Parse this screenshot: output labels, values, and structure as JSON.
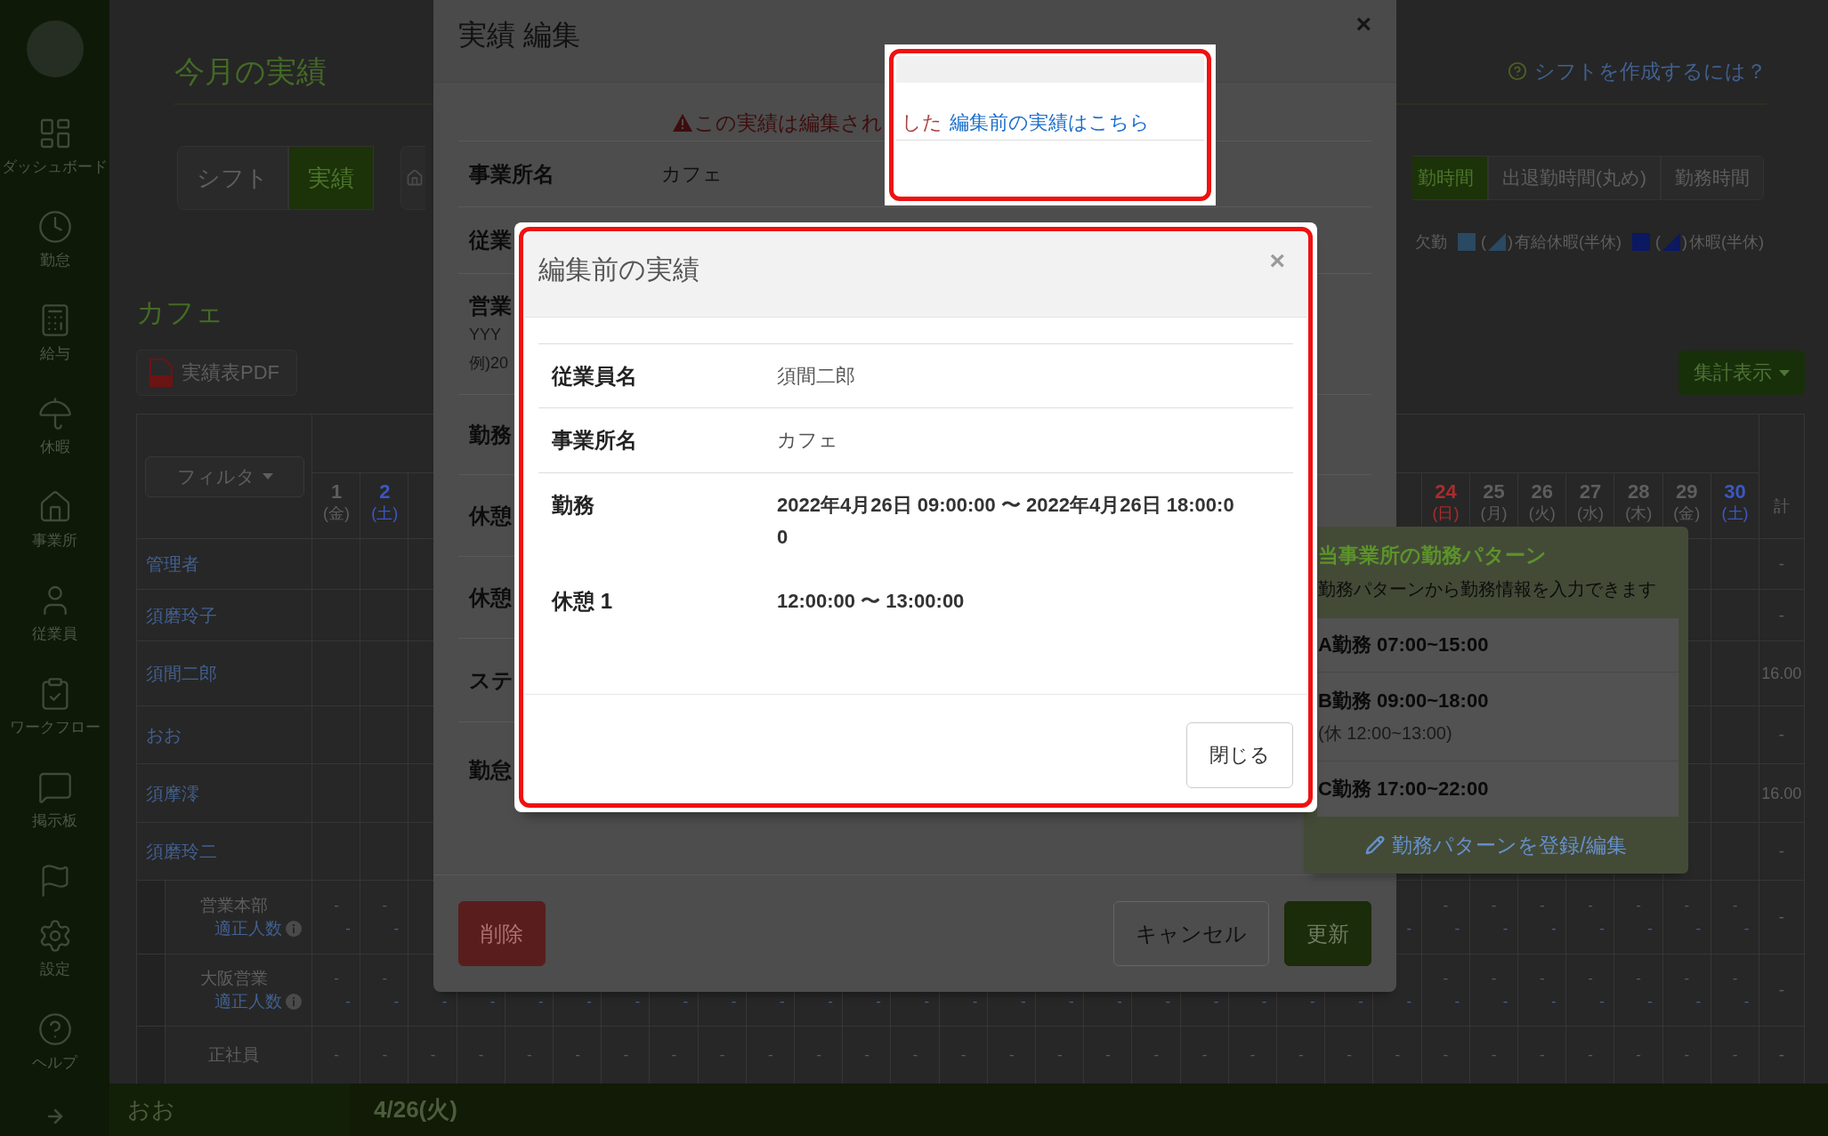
{
  "sidebar": {
    "items": [
      {
        "kind": "labeled",
        "label": "ダッシュボード"
      },
      {
        "kind": "labeled",
        "label": "勤怠"
      },
      {
        "kind": "labeled",
        "label": "給与"
      },
      {
        "kind": "labeled",
        "label": "休暇"
      },
      {
        "kind": "labeled",
        "label": "事業所"
      },
      {
        "kind": "labeled",
        "label": "従業員"
      },
      {
        "kind": "labeled",
        "label": "ワークフロー"
      },
      {
        "kind": "labeled",
        "label": "掲示板"
      },
      {
        "kind": "icon_only"
      },
      {
        "kind": "labeled",
        "label": "設定"
      },
      {
        "kind": "labeled",
        "label": "ヘルプ"
      }
    ]
  },
  "page_header": {
    "title": "今月の実績",
    "help_link": "シフトを作成するには？"
  },
  "mode_tabs": [
    {
      "label": "シフト",
      "selected": false
    },
    {
      "label": "実績",
      "selected": true
    }
  ],
  "time_buttons": [
    {
      "label": "勤時間",
      "selected": true
    },
    {
      "label": "出退勤時間(丸め)",
      "selected": false
    },
    {
      "label": "勤務時間",
      "selected": false
    }
  ],
  "legend": [
    {
      "label": "欠勤"
    },
    {
      "label": "有給休暇(半休)",
      "color": "#2a4962",
      "open": "(",
      "close": ")"
    },
    {
      "label": "休暇(半休)",
      "color": "#0b1862",
      "open": "(",
      "close": ")"
    }
  ],
  "section": {
    "title": "カフェ",
    "pdf_button": "実績表PDF",
    "summary_button": "集計表示"
  },
  "table": {
    "filter_button": "フィルタ",
    "days_left": [
      {
        "day": "1",
        "weekday": "(金)",
        "kind": "weekday"
      },
      {
        "day": "2",
        "weekday": "(土)",
        "kind": "saturday"
      }
    ],
    "days_right": [
      {
        "day": "24",
        "weekday": "(日)",
        "kind": "sunday"
      },
      {
        "day": "25",
        "weekday": "(月)",
        "kind": "weekday"
      },
      {
        "day": "26",
        "weekday": "(火)",
        "kind": "weekday"
      },
      {
        "day": "27",
        "weekday": "(水)",
        "kind": "weekday"
      },
      {
        "day": "28",
        "weekday": "(木)",
        "kind": "weekday"
      },
      {
        "day": "29",
        "weekday": "(金)",
        "kind": "weekday"
      },
      {
        "day": "30",
        "weekday": "(土)",
        "kind": "saturday"
      }
    ],
    "total_header": "計",
    "rows": [
      {
        "kind": "employee",
        "name": "管理者",
        "total": "-"
      },
      {
        "kind": "employee",
        "name": "須磨玲子",
        "total": "-"
      },
      {
        "kind": "employee",
        "name": "須間二郎",
        "total": "16.00"
      },
      {
        "kind": "employee",
        "name": "おお",
        "total": "-"
      },
      {
        "kind": "employee",
        "name": "須摩澪",
        "total": "16.00"
      },
      {
        "kind": "employee",
        "name": "須磨玲二",
        "total": "-"
      },
      {
        "kind": "group",
        "name": "営業本部",
        "sub": "適正人数",
        "top_left": [
          "-",
          "-"
        ],
        "top_right": [
          "-",
          "-",
          "-",
          "-",
          "-",
          "-",
          "-"
        ],
        "bottom_left": [
          "-",
          "-"
        ],
        "bottom_right": [
          "-",
          "-",
          "-",
          "-",
          "-",
          "-",
          "-",
          "-"
        ],
        "total": "-"
      },
      {
        "kind": "group",
        "name": "大阪営業",
        "sub": "適正人数",
        "top_left": [
          "-",
          "-"
        ],
        "top_right": [
          "-",
          "-",
          "-",
          "-",
          "-",
          "-",
          "-"
        ],
        "bottom_left": [
          "-",
          "-",
          "-",
          "-",
          "-",
          "-",
          "-",
          "-",
          "-",
          "-",
          "-",
          "-",
          "-",
          "-",
          "-",
          "-",
          "-",
          "-",
          "-",
          "-",
          "-",
          "-",
          "-",
          "-",
          "-",
          "-",
          "-",
          "-",
          "-",
          "-"
        ],
        "total": "-"
      },
      {
        "kind": "group",
        "name": "正社員",
        "top_left": [
          "-",
          "-",
          "-",
          "-",
          "-",
          "-",
          "-",
          "-",
          "-",
          "-",
          "-",
          "-",
          "-",
          "-",
          "-",
          "-",
          "-",
          "-",
          "-",
          "-",
          "-",
          "-",
          "-",
          "-",
          "-",
          "-",
          "-",
          "-",
          "-",
          "-"
        ],
        "total": "-"
      }
    ]
  },
  "status_bar": {
    "name": "おお",
    "date": "4/26(火)"
  },
  "edit_modal": {
    "title": "実績 編集",
    "close": "×",
    "warning": "この実績は編集され",
    "rows": [
      {
        "label": "事業所名",
        "value": "カフェ"
      },
      {
        "label": "従業"
      },
      {
        "label": "営業",
        "hints": [
          "YYY",
          "例)20"
        ]
      },
      {
        "label": "勤務"
      },
      {
        "label": "休憩"
      },
      {
        "label": "休憩"
      },
      {
        "label": "ステ"
      },
      {
        "label": "勤怠"
      }
    ],
    "buttons": [
      {
        "label": "削除",
        "kind": "danger"
      },
      {
        "label": "キャンセル",
        "kind": "default"
      },
      {
        "label": "更新",
        "kind": "primary"
      }
    ]
  },
  "callout": {
    "warning_end": "した",
    "link": "編集前の実績はこちら"
  },
  "pattern_panel": {
    "title": "当事業所の勤務パターン",
    "subtitle": "勤務パターンから勤務情報を入力できます",
    "patterns": [
      {
        "name": "A勤務 07:00~15:00"
      },
      {
        "name": "B勤務 09:00~18:00",
        "note": "(休 12:00~13:00)"
      },
      {
        "name": "C勤務 17:00~22:00"
      }
    ],
    "edit_link": "勤務パターンを登録/編集"
  },
  "before_edit_modal": {
    "title": "編集前の実績",
    "close": "×",
    "rows": [
      {
        "label": "従業員名",
        "value": "須間二郎",
        "bold": false
      },
      {
        "label": "事業所名",
        "value": "カフェ",
        "bold": false
      },
      {
        "label": "勤務",
        "value": "2022年4月26日 09:00:00 〜 2022年4月26日 18:00:00",
        "bold": true
      },
      {
        "label": "休憩 1",
        "value": "12:00:00 〜 13:00:00",
        "bold": true
      }
    ],
    "close_button": "閉じる"
  }
}
